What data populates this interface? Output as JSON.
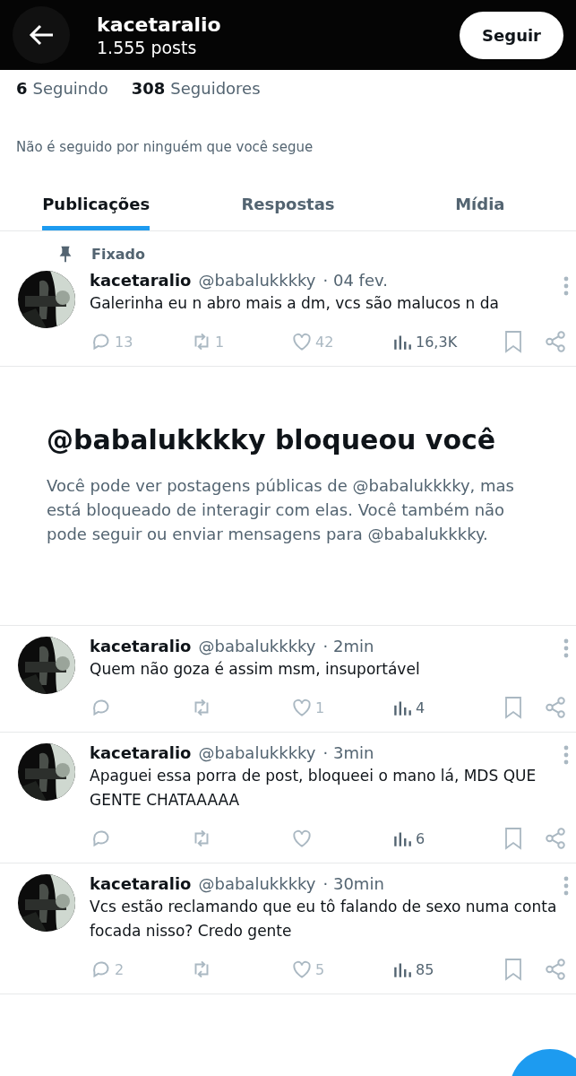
{
  "header": {
    "name": "kacetaralio",
    "posts": "1.555 posts",
    "follow_button": "Seguir"
  },
  "stats": [
    {
      "count": "6",
      "label": "Seguindo"
    },
    {
      "count": "308",
      "label": "Seguidores"
    }
  ],
  "followed_note": "Não é seguido por ninguém que você segue",
  "tabs": [
    {
      "label": "Publicações",
      "selected": true
    },
    {
      "label": "Respostas",
      "selected": false
    },
    {
      "label": "Mídia",
      "selected": false
    }
  ],
  "pinned_label": "Fixado",
  "posts": [
    {
      "pinned": true,
      "name": "kacetaralio",
      "handle": "@babalukkkky",
      "time": "· 04 fev.",
      "text": "Galerinha eu n abro mais a dm, vcs são malucos n da",
      "replies": "13",
      "reposts": "1",
      "likes": "42",
      "views": "16,3K"
    },
    {
      "pinned": false,
      "name": "kacetaralio",
      "handle": "@babalukkkky",
      "time": "· 2min",
      "text": "Quem não goza é assim msm, insuportável",
      "likes": "1",
      "views": "4"
    },
    {
      "pinned": false,
      "name": "kacetaralio",
      "handle": "@babalukkkky",
      "time": "· 3min",
      "text": "Apaguei essa porra de post, bloqueei o mano lá, MDS QUE GENTE CHATAAAAA",
      "views": "6"
    },
    {
      "pinned": false,
      "name": "kacetaralio",
      "handle": "@babalukkkky",
      "time": "· 30min",
      "text": "Vcs estão reclamando que eu tô falando de sexo numa conta focada nisso? Credo gente",
      "replies": "2",
      "likes": "5",
      "views": "85"
    }
  ],
  "block_notice": {
    "title": "@babalukkkky bloqueou você",
    "text": "Você pode ver postagens públicas de @babalukkkky, mas está bloqueado de interagir com elas. Você também não pode seguir ou enviar mensagens para @babalukkkky."
  }
}
